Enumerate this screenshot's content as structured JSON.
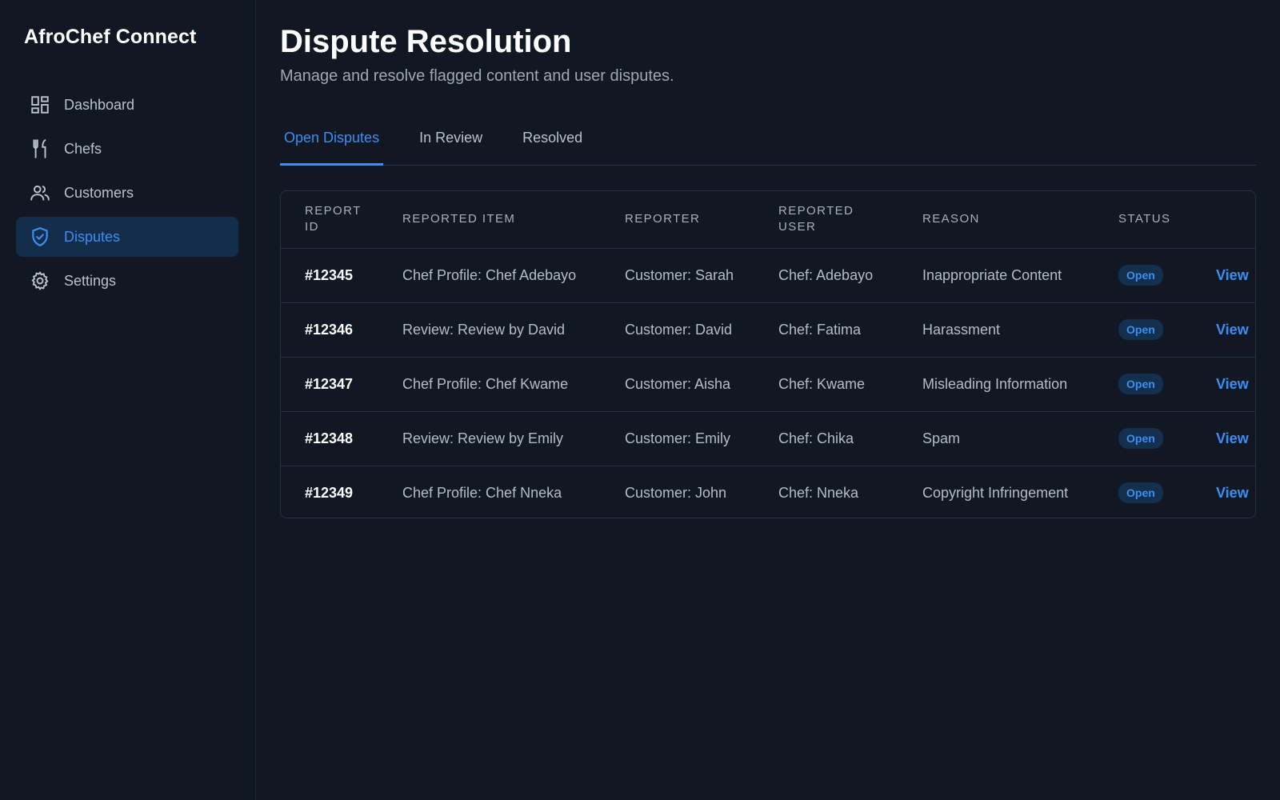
{
  "app": {
    "title": "AfroChef Connect"
  },
  "sidebar": {
    "items": [
      {
        "label": "Dashboard",
        "icon": "dashboard-icon",
        "active": false
      },
      {
        "label": "Chefs",
        "icon": "fork-knife-icon",
        "active": false
      },
      {
        "label": "Customers",
        "icon": "users-icon",
        "active": false
      },
      {
        "label": "Disputes",
        "icon": "shield-check-icon",
        "active": true
      },
      {
        "label": "Settings",
        "icon": "gear-icon",
        "active": false
      }
    ]
  },
  "header": {
    "title": "Dispute Resolution",
    "subtitle": "Manage and resolve flagged content and user disputes."
  },
  "tabs": [
    {
      "label": "Open Disputes",
      "active": true
    },
    {
      "label": "In Review",
      "active": false
    },
    {
      "label": "Resolved",
      "active": false
    }
  ],
  "table": {
    "columns": [
      "REPORT ID",
      "REPORTED ITEM",
      "REPORTER",
      "REPORTED USER",
      "REASON",
      "STATUS",
      ""
    ],
    "rows": [
      {
        "id": "#12345",
        "item": "Chef Profile: Chef Adebayo",
        "reporter": "Customer: Sarah",
        "reported_user": "Chef: Adebayo",
        "reason": "Inappropriate Content",
        "status": "Open",
        "action": "View"
      },
      {
        "id": "#12346",
        "item": "Review: Review by David",
        "reporter": "Customer: David",
        "reported_user": "Chef: Fatima",
        "reason": "Harassment",
        "status": "Open",
        "action": "View"
      },
      {
        "id": "#12347",
        "item": "Chef Profile: Chef Kwame",
        "reporter": "Customer: Aisha",
        "reported_user": "Chef: Kwame",
        "reason": "Misleading Information",
        "status": "Open",
        "action": "View"
      },
      {
        "id": "#12348",
        "item": "Review: Review by Emily",
        "reporter": "Customer: Emily",
        "reported_user": "Chef: Chika",
        "reason": "Spam",
        "status": "Open",
        "action": "View"
      },
      {
        "id": "#12349",
        "item": "Chef Profile: Chef Nneka",
        "reporter": "Customer: John",
        "reported_user": "Chef: Nneka",
        "reason": "Copyright Infringement",
        "status": "Open",
        "action": "View"
      }
    ]
  },
  "colors": {
    "accent": "#3b8ef2",
    "background": "#111823",
    "active_nav_bg": "#142d4b",
    "badge_bg": "#14304f"
  }
}
